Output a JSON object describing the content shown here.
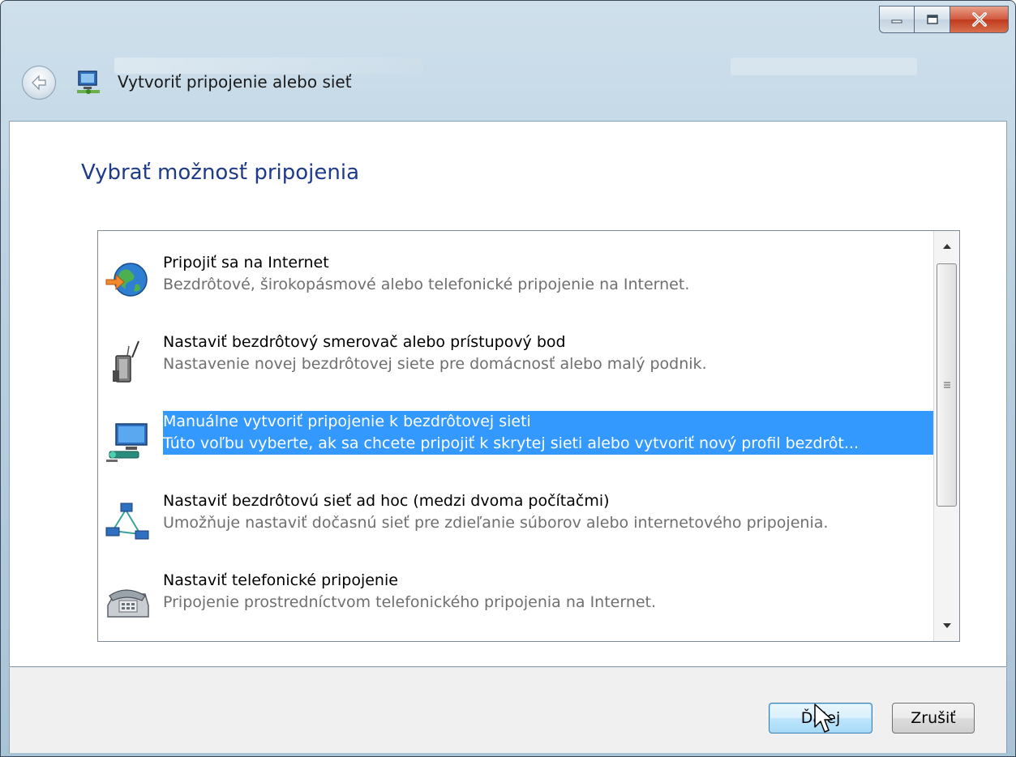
{
  "window": {
    "title": "Vytvoriť pripojenie alebo sieť",
    "controls": {
      "minimize": "minimize-icon",
      "maximize": "maximize-icon",
      "close": "close-icon"
    },
    "back_icon": "back-arrow-icon"
  },
  "main": {
    "heading": "Vybrať možnosť pripojenia",
    "options": [
      {
        "title": "Pripojiť sa na Internet",
        "desc": "Bezdrôtové, širokopásmové alebo telefonické pripojenie na Internet.",
        "icon": "globe-connect-icon",
        "selected": false
      },
      {
        "title": "Nastaviť bezdrôtový smerovač alebo prístupový bod",
        "desc": "Nastavenie novej bezdrôtovej siete pre domácnosť alebo malý podnik.",
        "icon": "wireless-router-icon",
        "selected": false
      },
      {
        "title": "Manuálne vytvoriť pripojenie k bezdrôtovej sieti",
        "desc": "Túto voľbu vyberte, ak sa chcete pripojiť k skrytej sieti alebo vytvoriť nový profil bezdrôt...",
        "icon": "manual-wireless-icon",
        "selected": true
      },
      {
        "title": "Nastaviť bezdrôtovú sieť ad hoc (medzi dvoma počítačmi)",
        "desc": "Umožňuje nastaviť dočasnú sieť pre zdieľanie súborov alebo internetového pripojenia.",
        "icon": "adhoc-network-icon",
        "selected": false
      },
      {
        "title": "Nastaviť telefonické pripojenie",
        "desc": "Pripojenie prostredníctvom telefonického pripojenia na Internet.",
        "icon": "dialup-phone-icon",
        "selected": false
      }
    ]
  },
  "footer": {
    "next_label": "Ďalej",
    "cancel_label": "Zrušiť"
  },
  "colors": {
    "heading": "#1e3a8a",
    "selection": "#3399ff",
    "desc": "#6f6f6f"
  }
}
